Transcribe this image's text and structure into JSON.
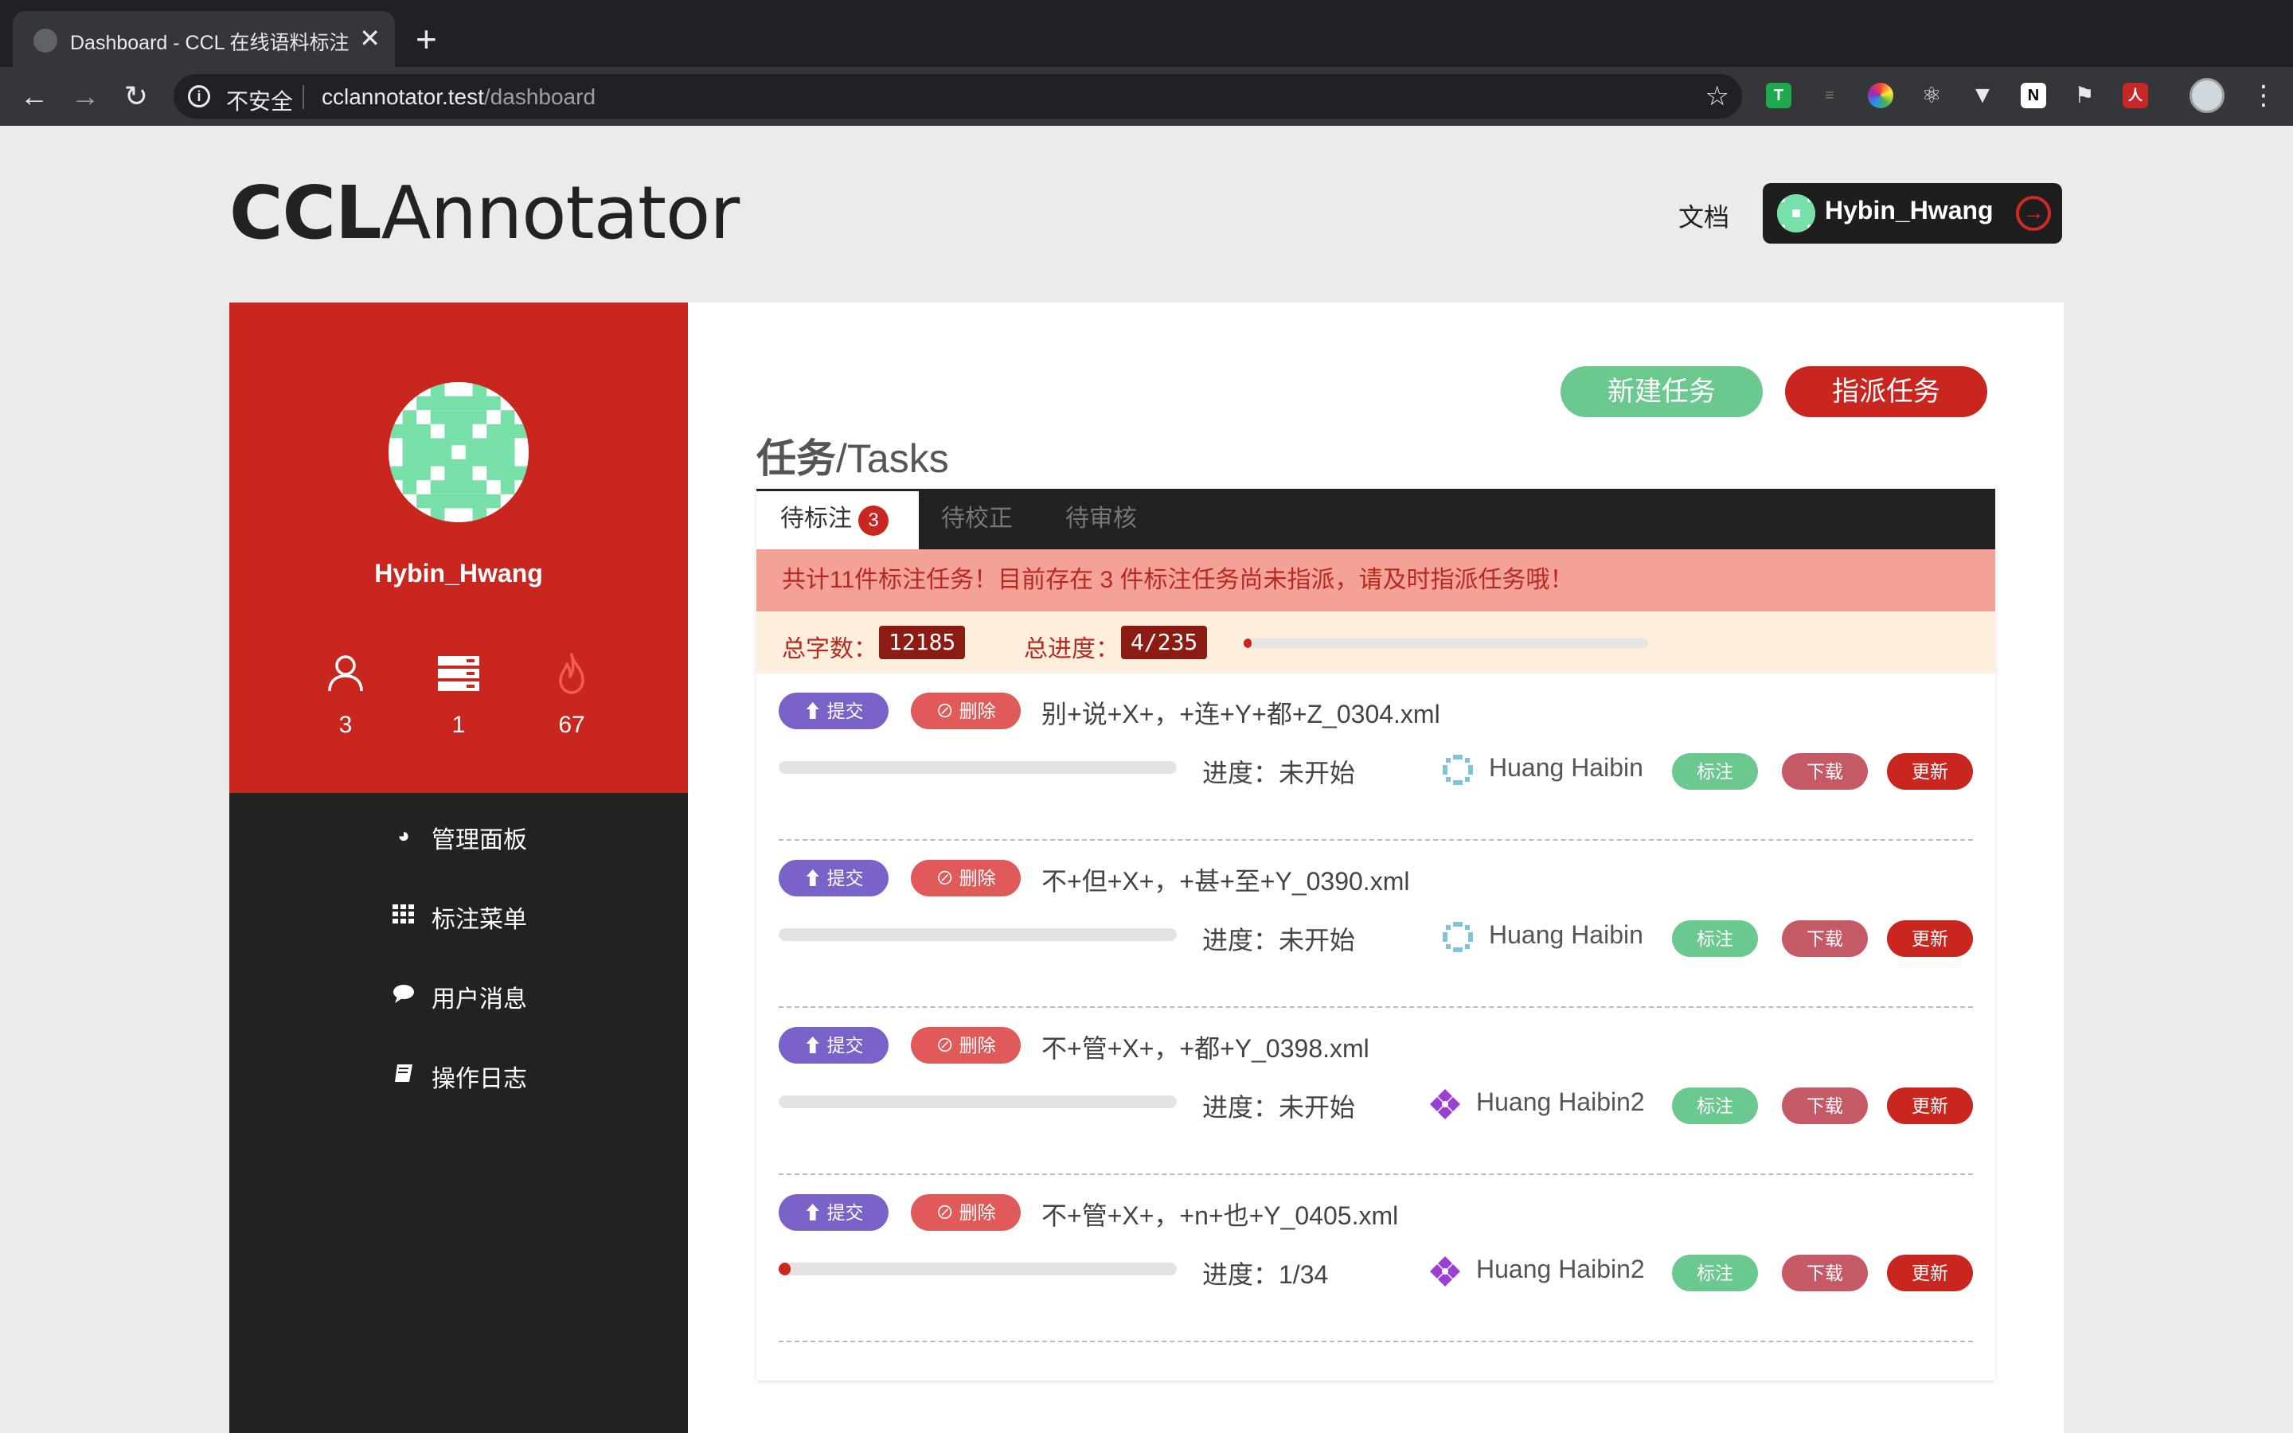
{
  "browser": {
    "tab_title": "Dashboard - CCL 在线语料标注...",
    "tab_close": "✕",
    "new_tab": "+",
    "back": "←",
    "forward": "→",
    "reload": "↻",
    "insecure_label": "不安全",
    "url_host": "cclannotator.test",
    "url_path": "/dashboard",
    "star": "☆",
    "menu": "⋮"
  },
  "header": {
    "logo_bold": "CCL",
    "logo_rest": "Annotator",
    "docs_link": "文档",
    "user_name": "Hybin_Hwang"
  },
  "sidebar": {
    "user_name": "Hybin_Hwang",
    "stats": [
      {
        "icon": "user-icon",
        "value": "3"
      },
      {
        "icon": "server-icon",
        "value": "1"
      },
      {
        "icon": "fire-icon",
        "value": "67"
      }
    ],
    "menu": [
      {
        "icon": "dashboard-icon",
        "label": "管理面板"
      },
      {
        "icon": "grid-icon",
        "label": "标注菜单"
      },
      {
        "icon": "comment-icon",
        "label": "用户消息"
      },
      {
        "icon": "book-icon",
        "label": "操作日志"
      }
    ]
  },
  "main": {
    "new_task_button": "新建任务",
    "assign_task_button": "指派任务",
    "title_zh": "任务",
    "title_en": "/Tasks",
    "tabs": [
      {
        "label": "待标注",
        "badge": "3"
      },
      {
        "label": "待校正"
      },
      {
        "label": "待审核"
      }
    ],
    "alert": "共计11件标注任务！目前存在 3 件标注任务尚未指派，请及时指派任务哦！",
    "total_chars_label": "总字数：",
    "total_chars_value": "12185",
    "total_progress_label": "总进度：",
    "total_progress_value": "4/235",
    "total_progress_fraction": 0.017
  },
  "tasks": [
    {
      "submit": "⬆ 提交",
      "delete": "⊘ 删除",
      "file": "别+说+X+，+连+Y+都+Z_0304.xml",
      "progress": "进度：未开始",
      "progress_fraction": 0,
      "assignee": "Huang Haibin",
      "annotate": "标注",
      "download": "下载",
      "update": "更新"
    },
    {
      "submit": "⬆ 提交",
      "delete": "⊘ 删除",
      "file": "不+但+X+，+甚+至+Y_0390.xml",
      "progress": "进度：未开始",
      "progress_fraction": 0,
      "assignee": "Huang Haibin",
      "annotate": "标注",
      "download": "下载",
      "update": "更新"
    },
    {
      "submit": "⬆ 提交",
      "delete": "⊘ 删除",
      "file": "不+管+X+，+都+Y_0398.xml",
      "progress": "进度：未开始",
      "progress_fraction": 0,
      "assignee": "Huang Haibin2",
      "annotate": "标注",
      "download": "下载",
      "update": "更新"
    },
    {
      "submit": "⬆ 提交",
      "delete": "⊘ 删除",
      "file": "不+管+X+，+n+也+Y_0405.xml",
      "progress": "进度：1/34",
      "progress_fraction": 0.03,
      "assignee": "Huang Haibin2",
      "annotate": "标注",
      "download": "下载",
      "update": "更新"
    }
  ],
  "colors": {
    "brand_red": "#c8261e",
    "green": "#6bc88f",
    "purple": "#7b62c9",
    "dark": "#222222"
  }
}
